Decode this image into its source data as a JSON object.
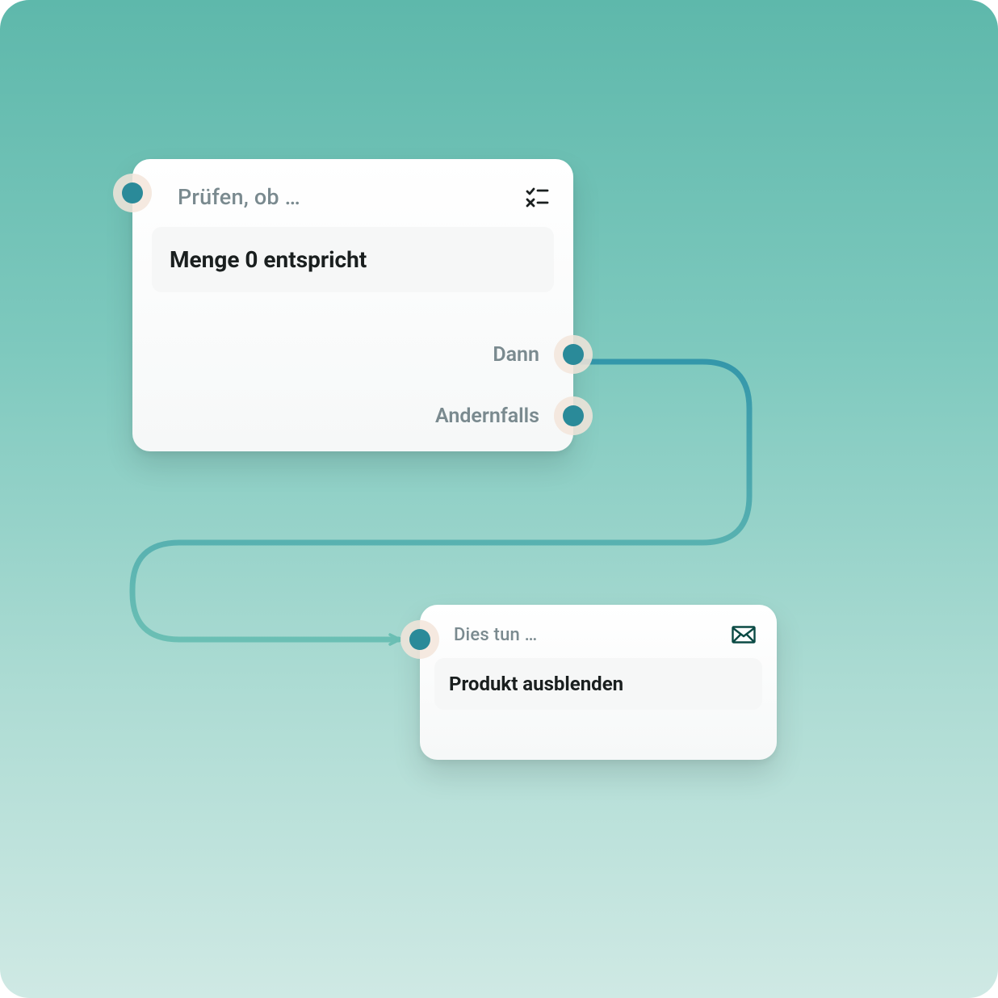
{
  "nodes": {
    "check": {
      "title": "Prüfen, ob …",
      "condition": "Menge 0 entspricht",
      "outputs": {
        "then": "Dann",
        "else": "Andernfalls"
      },
      "icon": "checklist-icon"
    },
    "action": {
      "title": "Dies tun …",
      "action_text": "Produkt ausblenden",
      "icon": "envelope-icon"
    }
  },
  "colors": {
    "accent": "#2a8a99",
    "connector_start": "#3497aa",
    "connector_end": "#6bbfb4"
  }
}
